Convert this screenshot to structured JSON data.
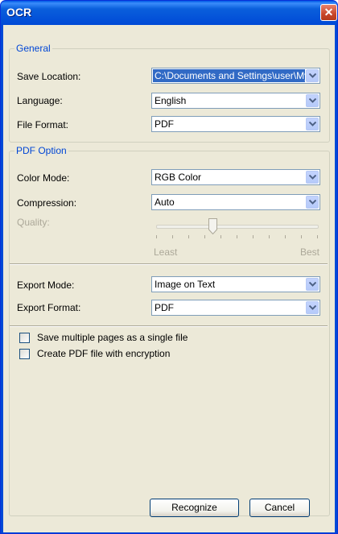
{
  "window": {
    "title": "OCR"
  },
  "general": {
    "legend": "General",
    "save_location": {
      "label": "Save Location:",
      "value": "C:\\Documents and Settings\\user\\My Do"
    },
    "language": {
      "label": "Language:",
      "value": "English"
    },
    "file_format": {
      "label": "File Format:",
      "value": "PDF"
    }
  },
  "pdf_option": {
    "legend": "PDF Option",
    "color_mode": {
      "label": "Color Mode:",
      "value": "RGB Color"
    },
    "compression": {
      "label": "Compression:",
      "value": "Auto"
    },
    "quality": {
      "label": "Quality:",
      "min_label": "Least",
      "max_label": "Best",
      "level": 0.35,
      "enabled": false
    },
    "export_mode": {
      "label": "Export Mode:",
      "value": "Image on Text"
    },
    "export_format": {
      "label": "Export Format:",
      "value": "PDF"
    },
    "options": [
      {
        "label": "Save multiple pages as a single file",
        "checked": false
      },
      {
        "label": "Create PDF file with encryption",
        "checked": false
      }
    ]
  },
  "buttons": {
    "recognize": "Recognize",
    "cancel": "Cancel"
  },
  "icons": {
    "close": "close-icon",
    "dropdown": "chevron-down-icon"
  },
  "colors": {
    "titlebar": "#0a5fdc",
    "legend_text": "#0046d5",
    "dialog_bg": "#ece9d8",
    "selection": "#316ac5"
  }
}
